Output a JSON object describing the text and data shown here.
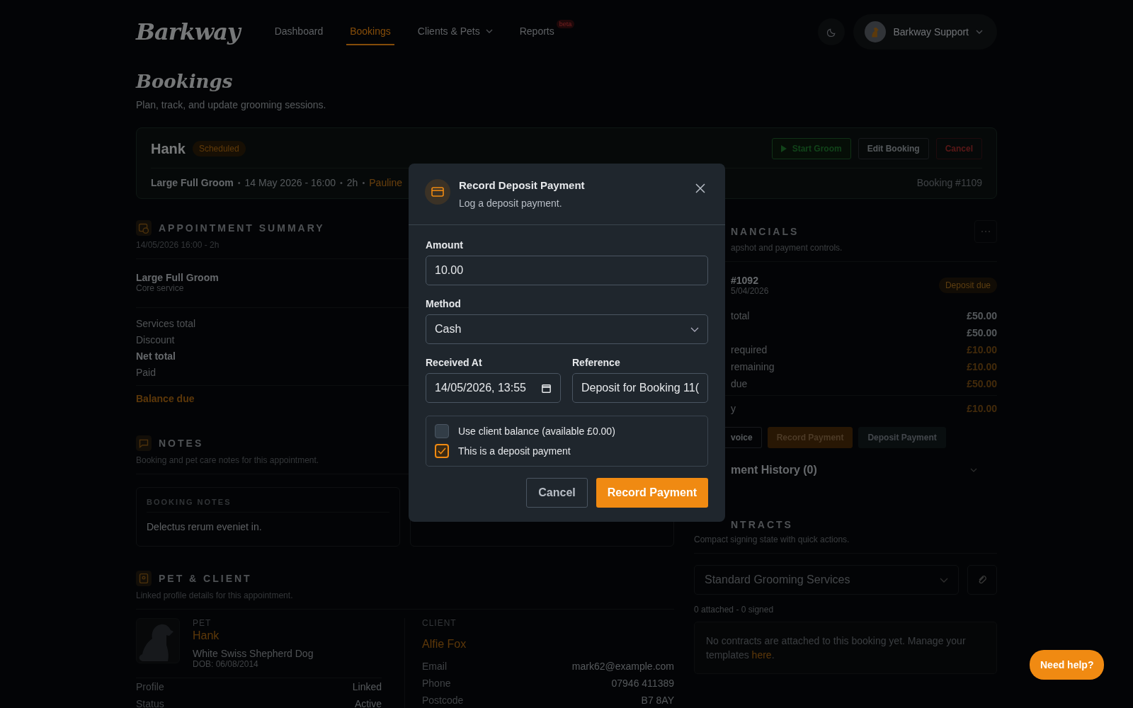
{
  "brand": "Barkway",
  "nav": [
    {
      "label": "Dashboard",
      "selected": false,
      "caret": false
    },
    {
      "label": "Bookings",
      "selected": true,
      "caret": false
    },
    {
      "label": "Clients & Pets",
      "selected": false,
      "caret": true
    },
    {
      "label": "Reports",
      "selected": false,
      "caret": false,
      "badge": "beta"
    }
  ],
  "user": {
    "name": "Barkway Support"
  },
  "page": {
    "title": "Bookings",
    "subtitle": "Plan, track, and update grooming sessions."
  },
  "booking": {
    "separator": "•",
    "pet": "Hank",
    "status": "Scheduled",
    "service": "Large Full Groom",
    "date": "14 May 2026 - 16:00",
    "duration": "2h",
    "groomer": "Pauline",
    "number": "Booking #1109",
    "actions": [
      {
        "label": "Start Groom",
        "kind": "start"
      },
      {
        "label": "Edit Booking",
        "kind": "outline"
      },
      {
        "label": "Cancel",
        "kind": "danger"
      }
    ]
  },
  "summary": {
    "title": "APPOINTMENT SUMMARY",
    "subtitle": "14/05/2026 16:00 - 2h",
    "service": "Large Full Groom",
    "service_note": "Core service",
    "rows": [
      {
        "label": "Services total",
        "bold": false
      },
      {
        "label": "Discount",
        "bold": false
      },
      {
        "label": "Net total",
        "bold": true
      },
      {
        "label": "Paid",
        "bold": false
      }
    ],
    "balance_label": "Balance due"
  },
  "notes": {
    "title": "NOTES",
    "subtitle": "Booking and pet care notes for this appointment.",
    "card_title": "BOOKING NOTES",
    "text": "Delectus rerum eveniet in."
  },
  "pet_client": {
    "title": "PET & CLIENT",
    "subtitle": "Linked profile details for this appointment.",
    "pet_label": "PET",
    "pet_name": "Hank",
    "breed": "White Swiss Shepherd Dog",
    "dob": "DOB: 06/08/2014",
    "pet_rows": [
      {
        "label": "Profile",
        "value": "Linked"
      },
      {
        "label": "Status",
        "value": "Active"
      }
    ],
    "client_label": "CLIENT",
    "client_name": "Alfie Fox",
    "client_rows": [
      {
        "label": "Email",
        "value": "mark62@example.com"
      },
      {
        "label": "Phone",
        "value": "07946 411389"
      },
      {
        "label": "Postcode",
        "value": "B7 8AY"
      }
    ]
  },
  "financials": {
    "title": "NANCIALS",
    "subtitle": "apshot and payment controls.",
    "invoice": "#1092",
    "invoice_date": "5/04/2026",
    "status": "Deposit due",
    "rows": [
      {
        "label": "total",
        "value": "£50.00",
        "accent": false
      },
      {
        "value": "£50.00",
        "accent": false
      },
      {
        "label": "required",
        "value": "£10.00",
        "accent": true
      },
      {
        "label": "remaining",
        "value": "£10.00",
        "accent": true
      },
      {
        "label": "due",
        "value": "£50.00",
        "accent": true
      }
    ],
    "total_label": "y",
    "total_value": "£10.00",
    "actions": [
      {
        "label": "voice",
        "kind": "outline"
      },
      {
        "label": "Record Payment",
        "kind": "primary"
      },
      {
        "label": "Deposit Payment",
        "kind": "secondary"
      }
    ],
    "history": "ment History (0)"
  },
  "contracts": {
    "title": "NTRACTS",
    "subtitle": "Compact signing state with quick actions.",
    "select_value": "Standard Grooming Services",
    "counts": "0 attached - 0 signed",
    "empty_before": "No contracts are attached to this booking yet. Manage your templates ",
    "empty_link": "here",
    "empty_after": "."
  },
  "modal": {
    "title": "Record Deposit Payment",
    "subtitle": "Log a deposit payment.",
    "amount_label": "Amount",
    "amount": "10.00",
    "method_label": "Method",
    "method": "Cash",
    "received_label": "Received At",
    "received": "14/05/2026, 13:55",
    "reference_label": "Reference",
    "reference": "Deposit for Booking 11(",
    "checks": [
      {
        "label": "Use client balance (available £0.00)",
        "checked": false
      },
      {
        "label": "This is a deposit payment",
        "checked": true
      }
    ],
    "cancel": "Cancel",
    "submit": "Record Payment"
  },
  "help": "Need help?"
}
